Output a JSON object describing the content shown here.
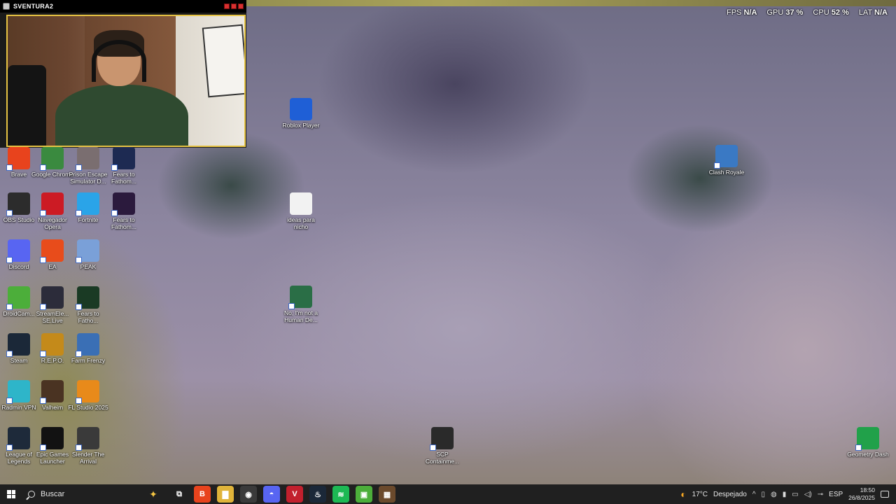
{
  "overlay": {
    "fps_label": "FPS",
    "fps_value": "N/A",
    "gpu_label": "GPU",
    "gpu_value": "37",
    "cpu_label": "CPU",
    "cpu_value": "52",
    "lat_label": "LAT",
    "lat_value": "N/A",
    "percent": "%"
  },
  "webcam": {
    "title": "SVENTURA2"
  },
  "desktop_icons": [
    {
      "label": "Roblox Player",
      "icon": "roblox-icon",
      "color": "#1f5fd6"
    },
    {
      "label": "Clash Royale",
      "icon": "clash-royale-icon",
      "color": "#3a79c4"
    },
    {
      "label": "ideas para nicho",
      "icon": "file-icon",
      "color": "#f2f2f2"
    },
    {
      "label": "No, I'm not a Human De...",
      "icon": "no-im-not-a-human-icon",
      "color": "#2a6e46"
    },
    {
      "label": "SCP Containme...",
      "icon": "scp-icon",
      "color": "#2a2a2a"
    },
    {
      "label": "Geometry Dash",
      "icon": "geometry-dash-icon",
      "color": "#21a14a"
    },
    {
      "label": "Brave",
      "icon": "brave-icon",
      "color": "#e8431d"
    },
    {
      "label": "Google Chrome",
      "icon": "chrome-icon",
      "color": "#3a8a3f"
    },
    {
      "label": "Prison Escape Simulator D...",
      "icon": "prison-escape-icon",
      "color": "#7a6e70"
    },
    {
      "label": "Fears to Fathom...",
      "icon": "fears-to-fathom-icon",
      "color": "#1d2a52"
    },
    {
      "label": "OBS Studio",
      "icon": "obs-icon",
      "color": "#2c2c2c"
    },
    {
      "label": "Navegador Opera",
      "icon": "opera-icon",
      "color": "#cc1b24"
    },
    {
      "label": "Fortnite",
      "icon": "fortnite-icon",
      "color": "#2aa4e8"
    },
    {
      "label": "Fears to Fathom...",
      "icon": "fears-to-fathom-icon",
      "color": "#2b1a3d"
    },
    {
      "label": "Discord",
      "icon": "discord-icon",
      "color": "#5865f2"
    },
    {
      "label": "EA",
      "icon": "ea-icon",
      "color": "#e84c1b"
    },
    {
      "label": "PEAK",
      "icon": "peak-icon",
      "color": "#7aa0d8"
    },
    {
      "label": "DroidCam...",
      "icon": "droidcam-icon",
      "color": "#4cae3a"
    },
    {
      "label": "StreamEle... SE.Live",
      "icon": "streamelements-icon",
      "color": "#2c2c3a"
    },
    {
      "label": "Fears to Fatho...",
      "icon": "fears-to-fathom-icon",
      "color": "#1a3a24"
    },
    {
      "label": "Steam",
      "icon": "steam-icon",
      "color": "#1b2838"
    },
    {
      "label": "R.E.P.O.",
      "icon": "repo-icon",
      "color": "#c48a1a"
    },
    {
      "label": "Farm Frenzy",
      "icon": "farm-frenzy-icon",
      "color": "#3a6fb5"
    },
    {
      "label": "Radmin VPN",
      "icon": "radmin-icon",
      "color": "#2eb5c9"
    },
    {
      "label": "Valheim",
      "icon": "valheim-icon",
      "color": "#4a3322"
    },
    {
      "label": "FL Studio 2025",
      "icon": "fl-studio-icon",
      "color": "#e88a1a"
    },
    {
      "label": "League of Legends",
      "icon": "league-icon",
      "color": "#1e2a3a"
    },
    {
      "label": "Epic Games Launcher",
      "icon": "epic-games-icon",
      "color": "#121212"
    },
    {
      "label": "Slender The Arrival",
      "icon": "slender-icon",
      "color": "#3a3a3a"
    }
  ],
  "taskbar": {
    "search_label": "Buscar",
    "apps": [
      {
        "name": "task-view-icon",
        "glyph": "⧉",
        "color": "#202020"
      },
      {
        "name": "brave-taskbar-icon",
        "glyph": "B",
        "color": "#e8431d"
      },
      {
        "name": "file-explorer-icon",
        "glyph": "▇",
        "color": "#e0b43a"
      },
      {
        "name": "obs-taskbar-icon",
        "glyph": "◉",
        "color": "#3a3a3a"
      },
      {
        "name": "discord-taskbar-icon",
        "glyph": "◓",
        "color": "#5865f2"
      },
      {
        "name": "voicemod-icon",
        "glyph": "V",
        "color": "#c2202d"
      },
      {
        "name": "steam-taskbar-icon",
        "glyph": "♨",
        "color": "#1b2838"
      },
      {
        "name": "spotify-icon",
        "glyph": "≋",
        "color": "#1db954"
      },
      {
        "name": "droidcam-taskbar-icon",
        "glyph": "▣",
        "color": "#4cae3a"
      },
      {
        "name": "minecraft-icon",
        "glyph": "▦",
        "color": "#6b4a2c"
      }
    ],
    "weather_temp": "17°C",
    "weather_desc": "Despejado",
    "lang": "ESP",
    "time": "18:50",
    "date": "26/8/2025"
  }
}
